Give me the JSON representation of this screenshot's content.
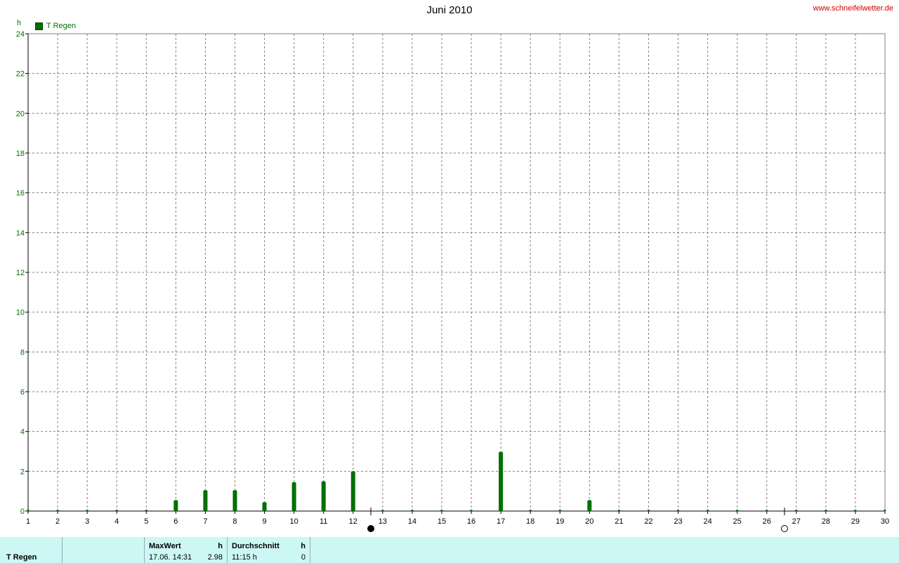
{
  "header": {
    "title": "Juni 2010",
    "site": "www.schneifelwetter.de",
    "unit": "h",
    "legend_label": "T Regen"
  },
  "colors": {
    "series": "#007000",
    "axis": "#007000",
    "grid": "#808080",
    "site": "#cc0000",
    "footer_bg": "#ccf7f4"
  },
  "chart_data": {
    "type": "bar",
    "title": "Juni 2010",
    "ylabel": "h",
    "xlabel": "",
    "x": [
      1,
      2,
      3,
      4,
      5,
      6,
      7,
      8,
      9,
      10,
      11,
      12,
      13,
      14,
      15,
      16,
      17,
      18,
      19,
      20,
      21,
      22,
      23,
      24,
      25,
      26,
      27,
      28,
      29,
      30
    ],
    "ylim": [
      0,
      24
    ],
    "yticks": [
      0,
      2,
      4,
      6,
      8,
      10,
      12,
      14,
      16,
      18,
      20,
      22,
      24
    ],
    "grid": true,
    "legend": "top-left",
    "series": [
      {
        "name": "T Regen",
        "values": [
          0,
          0,
          0,
          0,
          0,
          0.55,
          1.05,
          1.05,
          0.45,
          1.45,
          1.5,
          2.0,
          0,
          0,
          0,
          0,
          2.98,
          0,
          0,
          0.55,
          0,
          0,
          0,
          0,
          0,
          0,
          0,
          0,
          0,
          0
        ]
      }
    ],
    "moon_phases": [
      {
        "x": 12.6,
        "phase": "new"
      },
      {
        "x": 26.6,
        "phase": "full"
      }
    ]
  },
  "footer": {
    "name": "T Regen",
    "max_header": "MaxWert",
    "max_unit": "h",
    "max_date": "17.06.  14:31",
    "max_value": "2.98",
    "avg_header": "Durchschnitt",
    "avg_unit": "h",
    "avg_time": "11:15 h",
    "avg_value": "0"
  }
}
